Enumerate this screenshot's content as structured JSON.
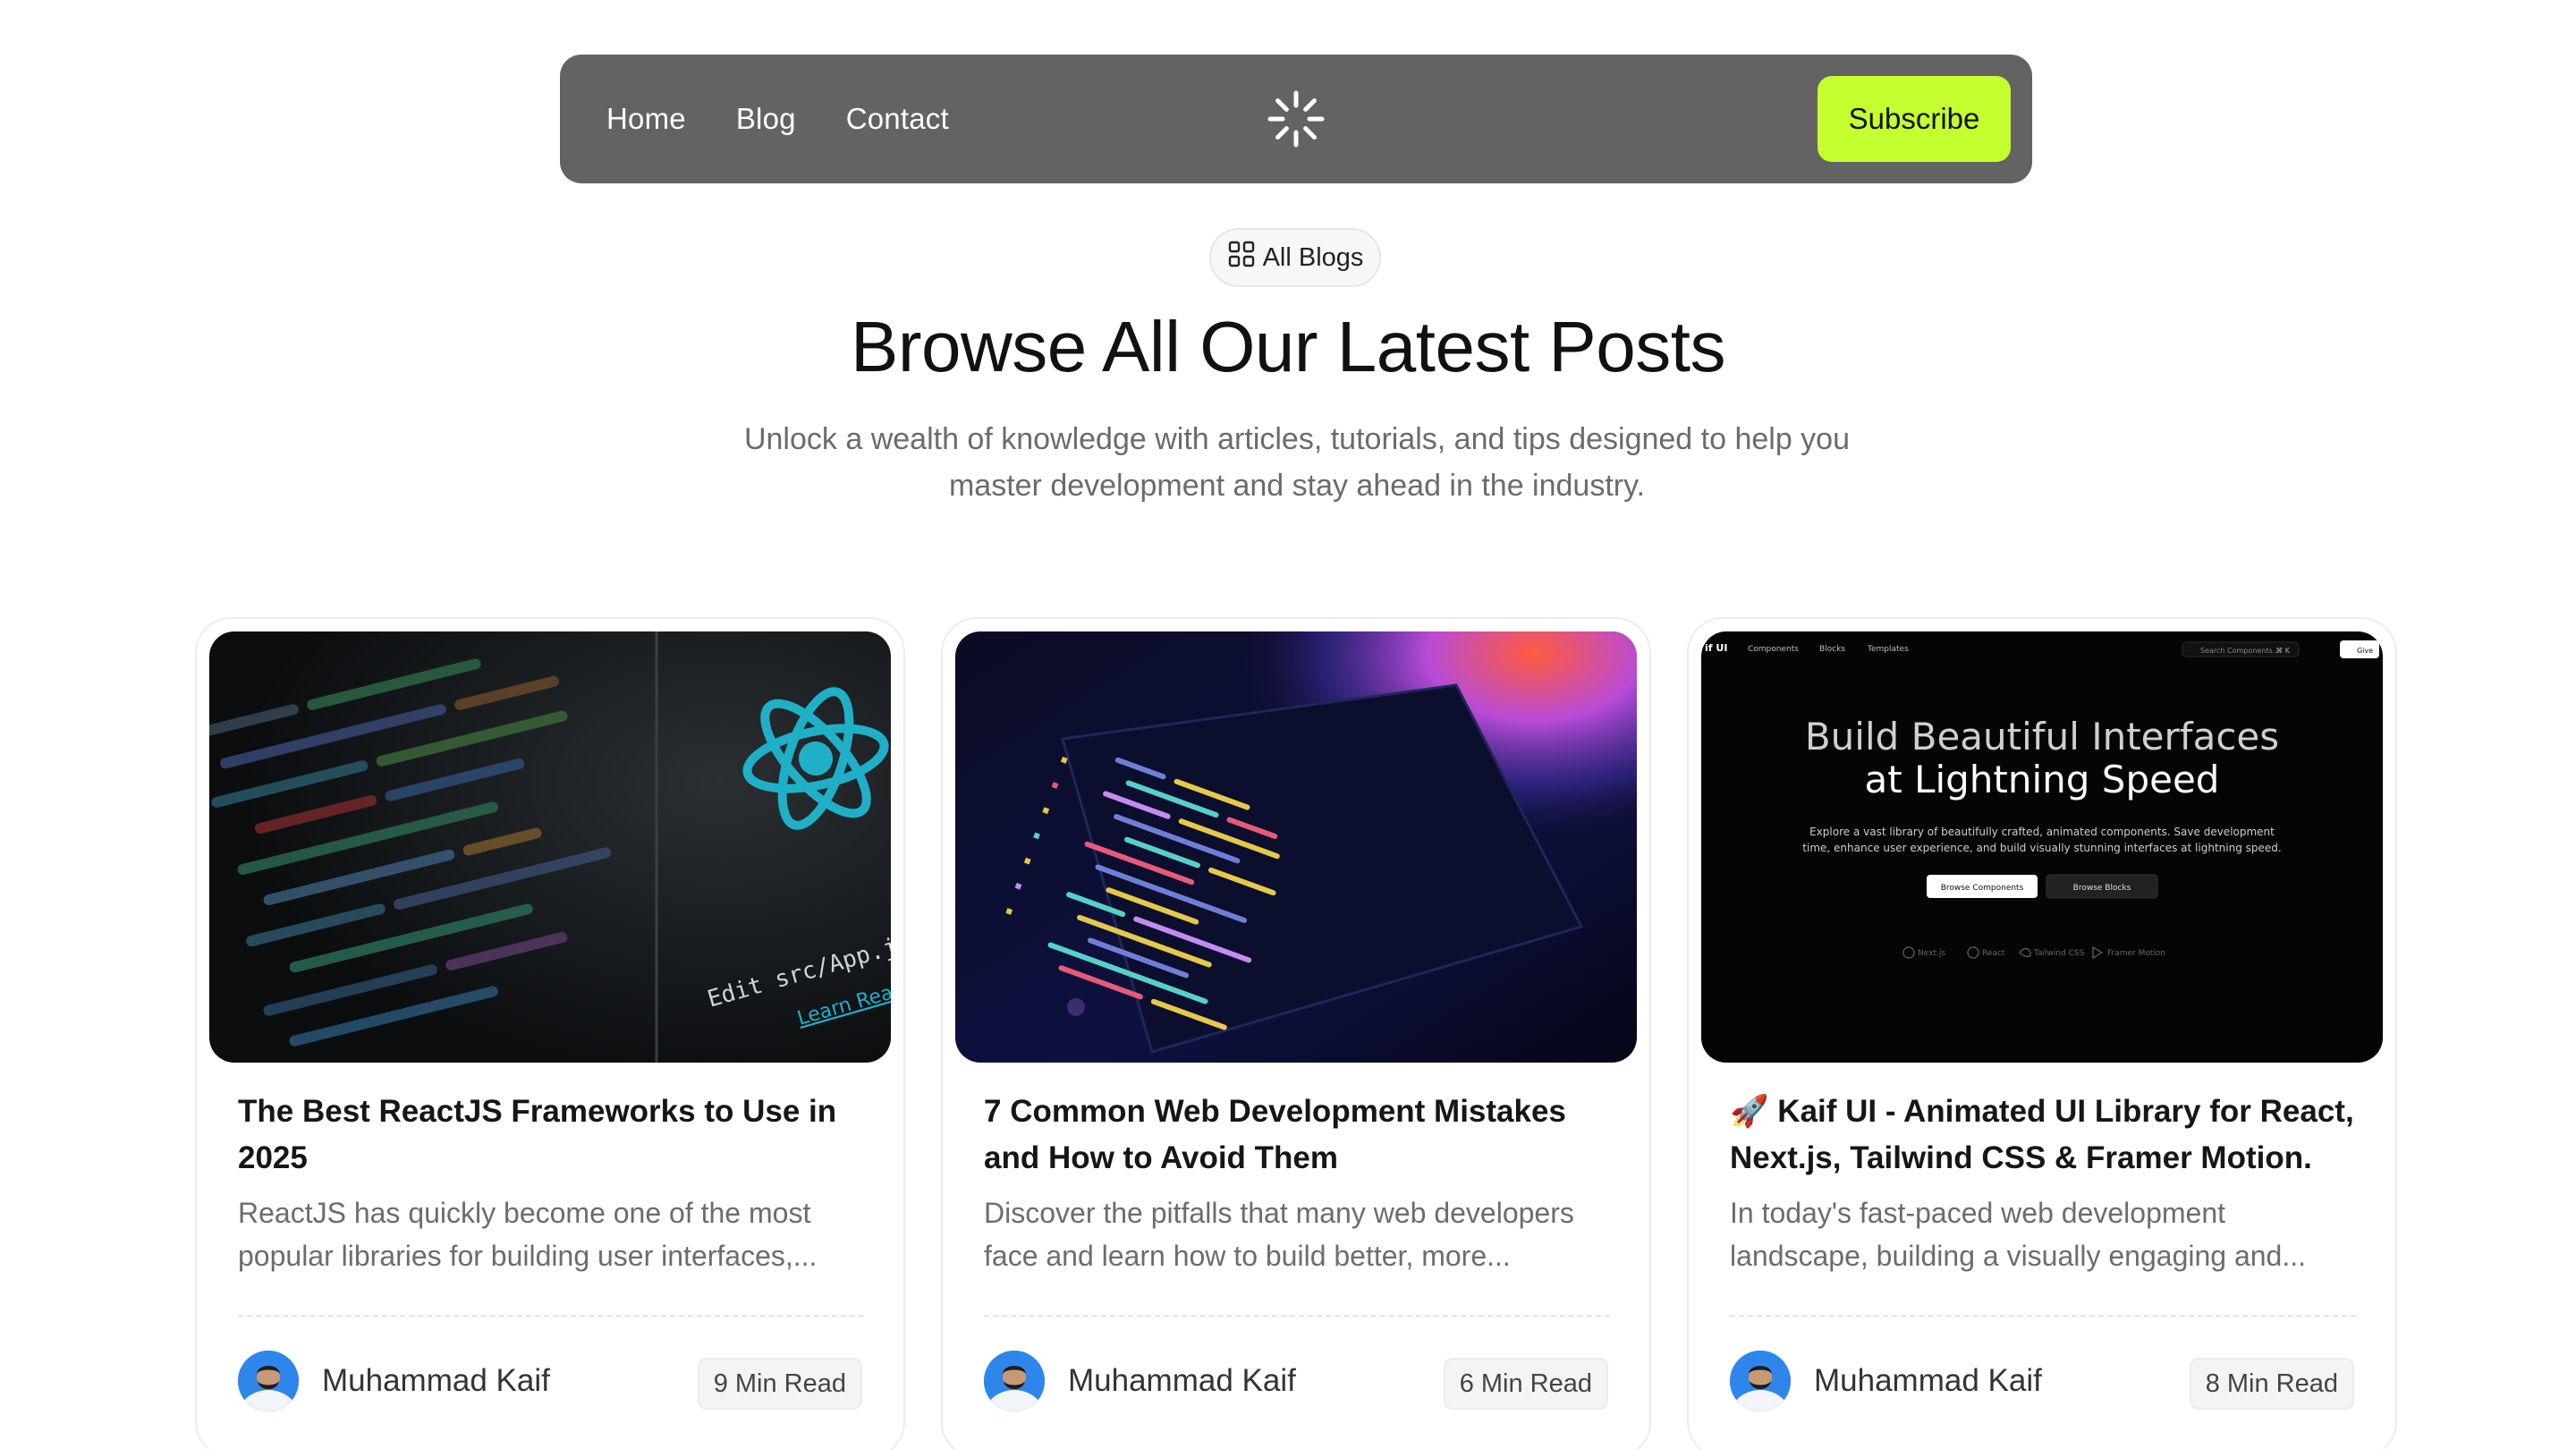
{
  "nav": {
    "links": [
      "Home",
      "Blog",
      "Contact"
    ],
    "subscribe_label": "Subscribe",
    "logo_icon": "loader-icon",
    "accent_color": "#c5ff2f",
    "bar_color": "#636363"
  },
  "hero": {
    "chip_label": "All Blogs",
    "chip_icon": "grid-icon",
    "title": "Browse All Our Latest Posts",
    "subtitle": "Unlock a wealth of knowledge with articles, tutorials, and tips designed to help you master development and stay ahead in the industry."
  },
  "cards": [
    {
      "title": " The Best ReactJS Frameworks to Use in 2025",
      "excerpt": "ReactJS has quickly become one of the most popular libraries for building user interfaces,...",
      "author": "Muhammad Kaif",
      "read_time": "9 Min Read",
      "image_text": [
        "Edit src/App.js and save to",
        "Learn React"
      ]
    },
    {
      "title": "7 Common Web Development Mistakes and How to Avoid Them",
      "excerpt": "Discover the pitfalls that many web developers face and learn how to build better, more...",
      "author": "Muhammad Kaif",
      "read_time": "6 Min Read",
      "image_text": []
    },
    {
      "title": "🚀 Kaif UI - Animated UI Library for React, Next.js, Tailwind CSS & Framer Motion.",
      "excerpt": "In today's fast-paced web development landscape, building a visually engaging and...",
      "author": "Muhammad Kaif",
      "read_time": "8 Min Read",
      "image_text": [
        "if UI",
        "Components",
        "Blocks",
        "Templates",
        "Search Components...",
        "⌘ K",
        "Give",
        "Build Beautiful Interfaces",
        "at Lightning Speed",
        "Explore a vast library of beautifully crafted, animated components. Save development",
        "time, enhance user experience, and build visually stunning interfaces at lightning speed.",
        "Browse Components",
        "Browse Blocks",
        "Next.js",
        "React",
        "Tailwind CSS",
        "Framer Motion"
      ]
    }
  ]
}
